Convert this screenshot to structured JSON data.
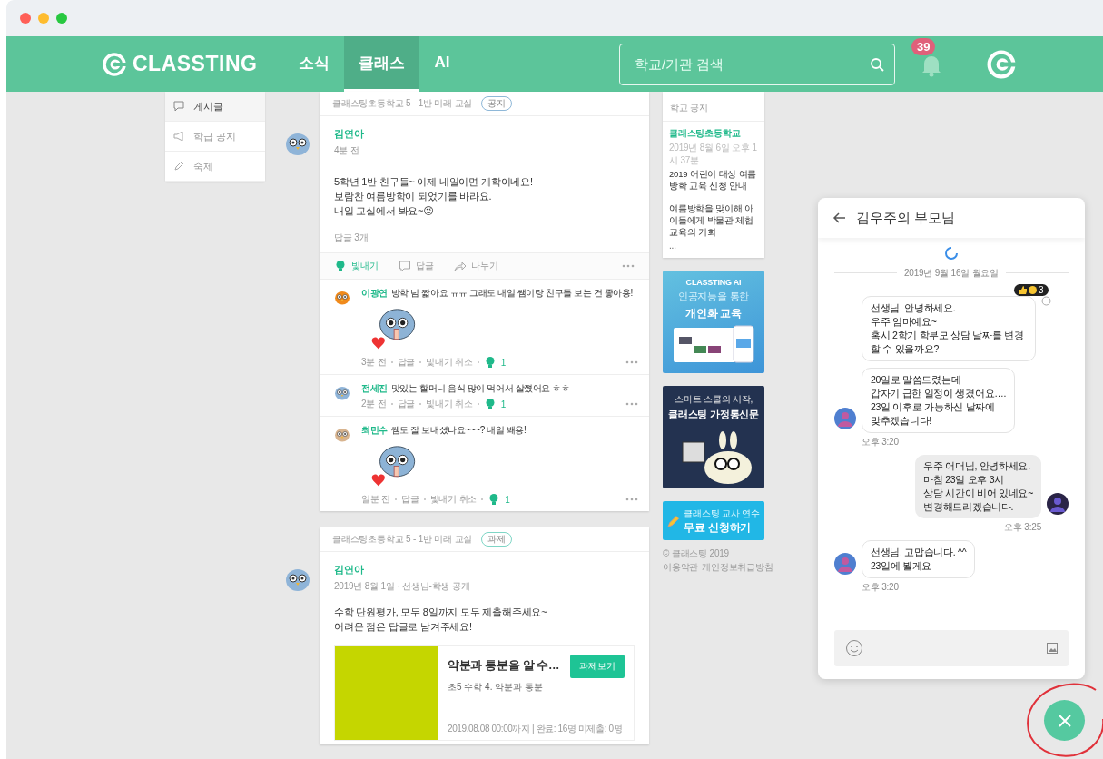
{
  "header": {
    "logo": "CLASSTING",
    "nav": [
      {
        "label": "소식",
        "selected": false
      },
      {
        "label": "클래스",
        "selected": true
      },
      {
        "label": "AI",
        "selected": false
      }
    ],
    "search": {
      "placeholder": "학교/기관 검색"
    },
    "notifications": "39"
  },
  "sidebar": {
    "items": [
      {
        "label": "게시글",
        "selected": true
      },
      {
        "label": "학급 공지",
        "selected": false
      },
      {
        "label": "숙제",
        "selected": false
      }
    ]
  },
  "posts": [
    {
      "kind": "notice",
      "classroom": "클래스팅초등학교 5 - 1반 미래 교실",
      "tag": "공지",
      "author": "김연아",
      "meta": "4분 전",
      "body": "5학년 1반 친구들~ 이제 내일이면 개학이네요!\n보람찬 여름방학이 되었기를 바라요.\n내일 교실에서 봐요~😉",
      "reply_count": "답글 3개",
      "actions": [
        {
          "label": "빛내기",
          "active": true
        },
        {
          "label": "답글",
          "active": false
        },
        {
          "label": "나누기",
          "active": false
        }
      ],
      "comments": [
        {
          "name": "이광연",
          "text": "방학 넘 짧아요 ㅠㅠ 그래도 내일 쌤이랑 친구들 보는 건 좋아용!",
          "has_sticker": true,
          "time": "3분 전",
          "reply": "답글",
          "unlike": "빛내기 취소",
          "likes": "1"
        },
        {
          "name": "전세진",
          "text": "맛있는 할머니 음식 많이 먹어서 살쪘어요 ㅎㅎ",
          "has_sticker": false,
          "time": "2분 전",
          "reply": "답글",
          "unlike": "빛내기 취소",
          "likes": "1"
        },
        {
          "name": "최민수",
          "text": "쌤도 잘 보내셨나요~~~? 내일 봬용!",
          "has_sticker": true,
          "time": "일분 전",
          "reply": "답글",
          "unlike": "빛내기 취소",
          "likes": "1"
        }
      ]
    },
    {
      "kind": "assignment",
      "classroom": "클래스팅초등학교 5 - 1반 미래 교실",
      "tag": "과제",
      "author": "김연아",
      "meta": "2019년 8월 1일 · 선생님-학생 공개",
      "body": "수학 단원평가, 모두 8일까지 모두 제출해주세요~\n어려운 점은 답글로 남겨주세요!",
      "assignment": {
        "title": "약분과 통분을 알 수…",
        "subtitle": "초5 수학 4. 약분과 통분",
        "button": "과제보기",
        "footer": "2019.08.08 00:00까지 | 완료: 16명 미제출: 0명"
      }
    }
  ],
  "notice": {
    "heading": "학교 공지",
    "school": "클래스팅초등학교",
    "date": "2019년 8월 6일 오후 1시 37분",
    "title": "2019 어린이 대상 여름방학 교육 신청 안내",
    "excerpt": "여름방학을 맞이해 아이들에게 박물관 체험 교육의 기회",
    "more": "..."
  },
  "banners": [
    {
      "kind": "ai",
      "brand": "CLASSTING AI",
      "line1": "인공지능을 통한",
      "line2": "개인화 교육"
    },
    {
      "kind": "newsletter",
      "line1": "스마트 스쿨의 시작,",
      "line2": "클래스팅 가정통신문"
    },
    {
      "kind": "training",
      "line1": "클래스팅 교사 연수",
      "line2": "무료 신청하기"
    }
  ],
  "footer": {
    "copyright": "© 클래스팅 2019",
    "links": [
      "이용약관",
      "개인정보취급방침"
    ]
  },
  "chat": {
    "title": "김우주의 부모님",
    "date": "2019년 9월 16일 월요일",
    "messages": [
      {
        "kind": "incoming",
        "text": "선생님, 안녕하세요.\n우주 엄마예요~\n혹시 2학기 학부모 상담 날짜를 변경할 수 있을까요?",
        "reactions": "3"
      },
      {
        "kind": "incoming",
        "text": "20일로 말씀드렸는데\n갑자기 급한 일정이 생겼어요….\n23일 이후로 가능하신 날짜에\n맞추겠습니다!",
        "time": "오후 3:20"
      },
      {
        "kind": "outgoing",
        "text": "우주 어머님, 안녕하세요.\n마침 23일 오후 3시\n상담 시간이 비어 있네요~\n변경해드리겠습니다.",
        "time": "오후 3:25"
      },
      {
        "kind": "incoming",
        "text": "선생님, 고맙습니다. ^^\n23일에 뵐게요",
        "time": "오후 3:20"
      }
    ]
  },
  "fab": {
    "open": true
  }
}
